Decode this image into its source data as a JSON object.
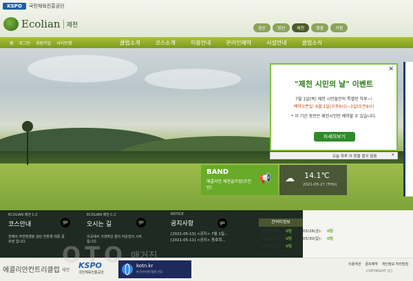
{
  "header": {
    "kspo_logo": "KSPO",
    "kspo_name": "국민체육진흥공단",
    "brand": "Ecolian",
    "brand_sub": "제천",
    "sites": [
      "광산",
      "정선",
      "제천",
      "영광",
      "거창"
    ],
    "active_site": "제천"
  },
  "nav": {
    "util": [
      "홈",
      "로그인",
      "회원가입",
      "사이트맵"
    ],
    "menu": [
      "클럽소개",
      "코스소개",
      "이용안내",
      "온라인예약",
      "시설안내",
      "클럽소식"
    ]
  },
  "popup": {
    "close": "✕",
    "title": "\"제천 시민의 날\" 이벤트",
    "line1": "7월 1일(목) 제천 시민들만의 특별한 하루~!",
    "line2": "예약오픈일: 6월 1일(오후9시)~3일(오전9시)",
    "line3": "* 이 기간 동안은 제천시민만 예약할 수 있습니다.",
    "button": "자세히보기",
    "footer_text": "오늘 하루 이 창을 열지 않음",
    "footer_close": "✕"
  },
  "band": {
    "title": "BAND",
    "subtitle": "에콜리안 제천골프장(조인방)"
  },
  "weather": {
    "icon": "cloud-icon",
    "temp": "14.1℃",
    "date": "2021-05-27 (THU)"
  },
  "cards": [
    {
      "kicker": "ECOLIAN 제천 C.C",
      "title": "코스안내",
      "desc": "천혜의 자연환경을 살린 친환경 대중 골프장 입니다.",
      "go": "go"
    },
    {
      "kicker": "ECOLIAN 제천 C.C",
      "title": "오시는 길",
      "desc": "이곳에서 기대하던 꿈의 라운딩이 시작됩니다.",
      "go": "go"
    }
  ],
  "notice": {
    "kicker": "NOTICE",
    "title": "공지사항",
    "go": "go",
    "items": [
      "[2021-05-13] <공지> 7월 1일...",
      "[2021-05-11] <공지> 동호회..."
    ]
  },
  "reservation": {
    "title": "잔여티정보",
    "rows": [
      {
        "date": "05/27(목):",
        "count": "0팀"
      },
      {
        "date": "05/29(토):",
        "count": "0팀"
      },
      {
        "date": "05/31(월):",
        "count": "0팀"
      }
    ],
    "rows_right": [
      {
        "date": "05/28(금):",
        "count": "0팀"
      },
      {
        "date": "05/30(일):",
        "count": "0팀"
      }
    ]
  },
  "footer": {
    "brand": "에콜리안컨트리클럽",
    "brand_sub": "제천",
    "kspo_logo": "KSPO",
    "kspo_name": "국민체육진흥공단",
    "badge_title": "kotn.kr",
    "badge_sub": "한국인터넷진흥원 인증",
    "links": [
      "이용약관",
      "골프예약",
      "개인정보 처리방침"
    ],
    "copyright": "COPYRIGHT (C)"
  },
  "watermark": {
    "text1": "OTO",
    "text2": "매거진"
  }
}
